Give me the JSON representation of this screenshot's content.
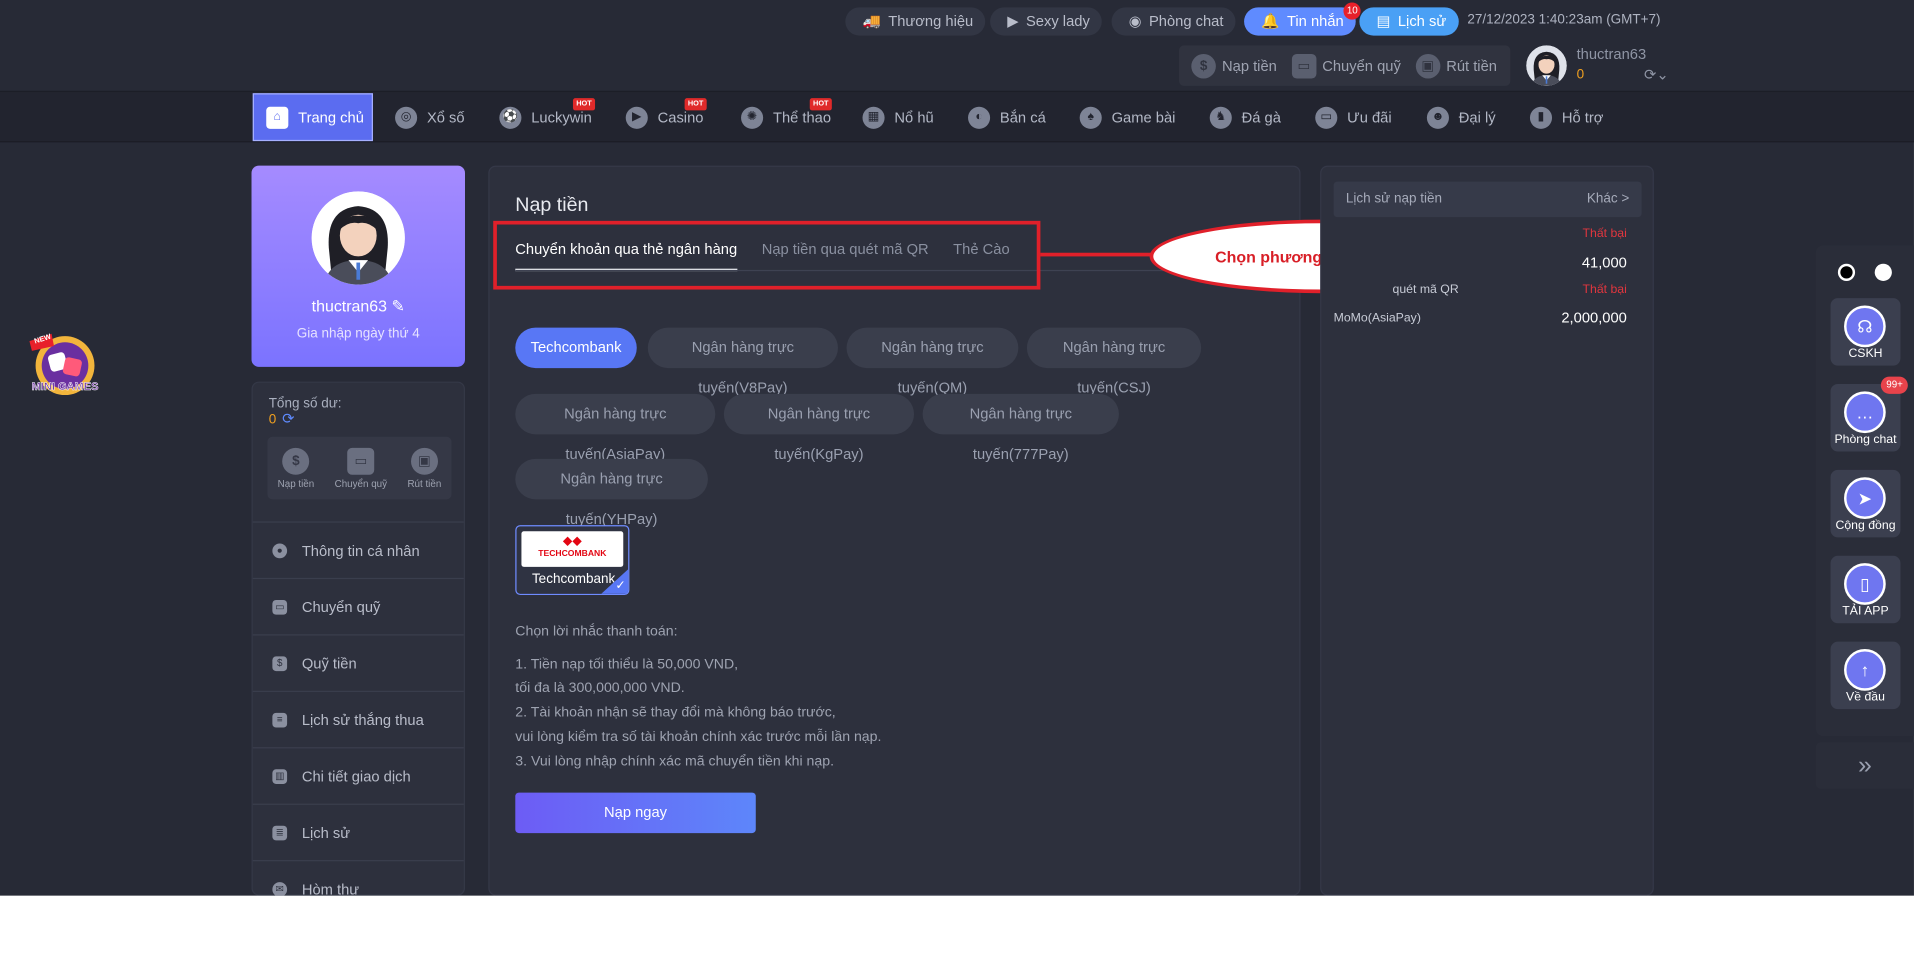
{
  "topbar": {
    "pills": [
      {
        "label": "Thương hiệu",
        "icon": "truck-icon"
      },
      {
        "label": "Sexy lady",
        "icon": "play-icon"
      },
      {
        "label": "Phòng chat",
        "icon": "chat-icon"
      },
      {
        "label": "Tin nhắn",
        "icon": "bell-icon",
        "badge": "10"
      },
      {
        "label": "Lịch sử",
        "icon": "history-icon"
      }
    ],
    "datetime": "27/12/2023 1:40:23am (GMT+7)",
    "wallet": [
      {
        "label": "Nạp tiền",
        "icon": "deposit-icon"
      },
      {
        "label": "Chuyển quỹ",
        "icon": "wallet-icon"
      },
      {
        "label": "Rút tiền",
        "icon": "withdraw-icon"
      }
    ],
    "username": "thuctran63",
    "balance": "0"
  },
  "nav": [
    {
      "label": "Trang chủ",
      "icon": "home-icon"
    },
    {
      "label": "Xổ số",
      "icon": "lottery-icon"
    },
    {
      "label": "Luckywin",
      "icon": "soccer-ball-icon",
      "hot": true
    },
    {
      "label": "Casino",
      "icon": "casino-icon",
      "hot": true
    },
    {
      "label": "Thể thao",
      "icon": "sports-icon",
      "hot": true
    },
    {
      "label": "Nổ hũ",
      "icon": "slot-icon"
    },
    {
      "label": "Bắn cá",
      "icon": "fish-icon"
    },
    {
      "label": "Game bài",
      "icon": "cards-icon"
    },
    {
      "label": "Đá gà",
      "icon": "rooster-icon"
    },
    {
      "label": "Ưu đãi",
      "icon": "gift-icon"
    },
    {
      "label": "Đại lý",
      "icon": "agent-icon"
    },
    {
      "label": "Hỗ trợ",
      "icon": "book-icon"
    }
  ],
  "hot_label": "HOT",
  "profile": {
    "username": "thuctran63",
    "joined": "Gia nhập ngày thứ 4",
    "balance_label": "Tổng số dư:",
    "balance": "0",
    "actions": [
      {
        "label": "Nạp tiền",
        "icon": "deposit-icon"
      },
      {
        "label": "Chuyển quỹ",
        "icon": "wallet-icon"
      },
      {
        "label": "Rút tiền",
        "icon": "withdraw-icon"
      }
    ],
    "menu": [
      {
        "label": "Thông tin cá nhân",
        "icon": "user-icon"
      },
      {
        "label": "Chuyển quỹ",
        "icon": "wallet-icon"
      },
      {
        "label": "Quỹ tiền",
        "icon": "fund-icon"
      },
      {
        "label": "Lịch sử thắng thua",
        "icon": "clipboard-icon"
      },
      {
        "label": "Chi tiết giao dịch",
        "icon": "transactions-icon"
      },
      {
        "label": "Lịch sử",
        "icon": "coins-icon"
      },
      {
        "label": "Hòm thư",
        "icon": "mailbox-icon"
      }
    ]
  },
  "deposit": {
    "title": "Nạp tiền",
    "tabs": [
      "Chuyển khoản qua thẻ ngân hàng",
      "Nạp tiền qua quét mã QR",
      "Thẻ Cào"
    ],
    "annotation": "Chọn phương thức nạp tiền",
    "banks": [
      "Techcombank",
      "Ngân hàng trực tuyến(V8Pay)",
      "Ngân hàng trực tuyến(QM)",
      "Ngân hàng trực tuyến(CSJ)",
      "Ngân hàng trực tuyến(AsiaPay)",
      "Ngân hàng trực tuyến(KgPay)",
      "Ngân hàng trực tuyến(777Pay)",
      "Ngân hàng trực tuyến(YHPay)"
    ],
    "selected_card": {
      "logo_text": "TECHCOMBANK",
      "name": "Techcombank"
    },
    "notes_title": "Chọn lời nhắc thanh toán:",
    "notes": [
      "1. Tiền nạp tối thiểu là 50,000 VND,",
      "tối đa là 300,000,000 VND.",
      "2. Tài khoản nhận sẽ thay đổi mà không báo trước,",
      "vui lòng kiểm tra số tài khoản chính xác trước mỗi lần nạp.",
      "3. Vui lòng nhập chính xác mã chuyển tiền khi nạp."
    ],
    "submit": "Nạp ngay"
  },
  "history": {
    "title": "Lịch sử nạp tiền",
    "more": "Khác >",
    "rows": [
      {
        "status": "Thất bại",
        "amount": "41,000",
        "method": "quét mã QR"
      },
      {
        "status": "Thất bại",
        "amount": "2,000,000",
        "method": "MoMo(AsiaPay)"
      }
    ]
  },
  "dock": [
    {
      "label": "CSKH",
      "icon": "headset-icon"
    },
    {
      "label": "Phòng chat",
      "icon": "chat-bubble-icon",
      "badge": "99+"
    },
    {
      "label": "Cộng đồng",
      "icon": "send-icon"
    },
    {
      "label": "TẢI APP",
      "icon": "phone-icon"
    },
    {
      "label": "Về đầu",
      "icon": "arrow-up-icon"
    }
  ],
  "minigames_label": "MINI GAMES",
  "minigames_badge": "NEW",
  "colors": {
    "accent": "#5b6cf0",
    "annotation_red": "#e0202a",
    "balance": "#f0a020",
    "failed": "#e0363e"
  }
}
